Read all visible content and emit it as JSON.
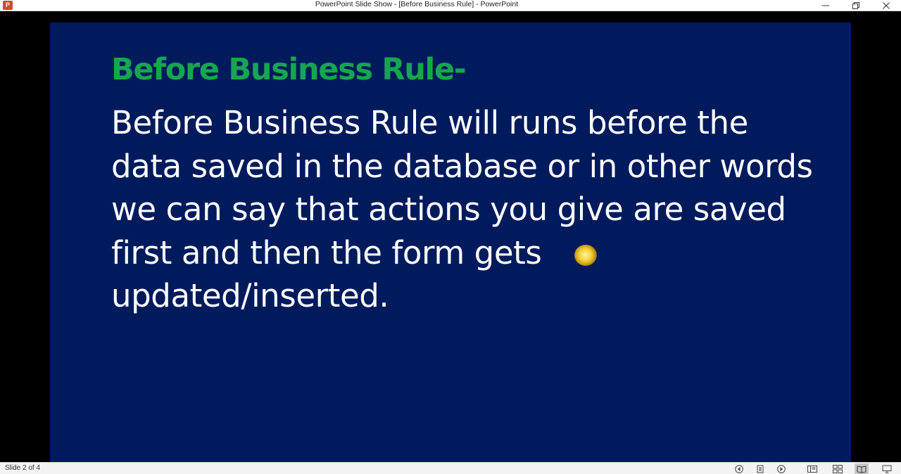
{
  "titlebar": {
    "app_icon_label": "P",
    "title": "PowerPoint Slide Show - [Before Business Rule] - PowerPoint",
    "minimize_icon": "minimize-icon",
    "restore_icon": "restore-icon",
    "close_icon": "close-icon"
  },
  "slide": {
    "heading": "Before Business Rule-",
    "body": "Before Business Rule will runs before the data saved in the database or in other words we can say that actions you give are saved first and then the form gets updated/inserted.",
    "background_color": "#001b5c",
    "heading_color": "#16a651",
    "body_color": "#ffffff"
  },
  "statusbar": {
    "slide_counter": "Slide 2 of 4",
    "icons": [
      "previous-slide-icon",
      "slide-menu-icon",
      "next-slide-icon",
      "normal-view-icon",
      "slide-sorter-icon",
      "reading-view-icon",
      "slide-show-icon"
    ]
  }
}
